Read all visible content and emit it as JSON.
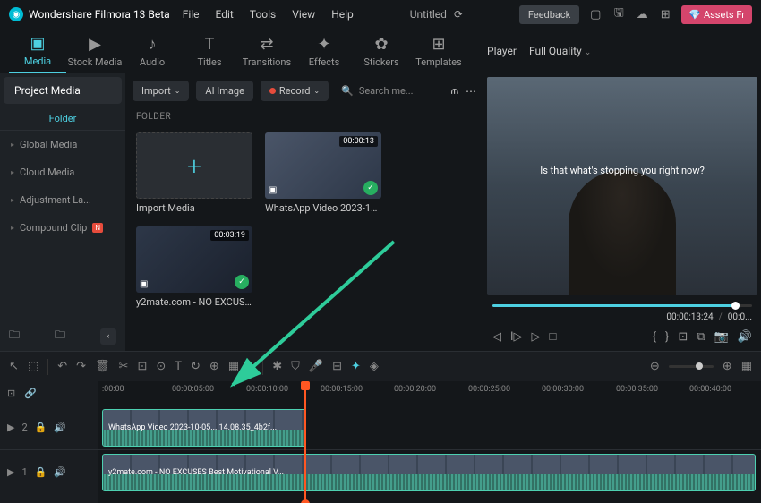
{
  "app": {
    "name": "Wondershare Filmora 13 Beta"
  },
  "menu": [
    "File",
    "Edit",
    "Tools",
    "View",
    "Help"
  ],
  "title": "Untitled",
  "feedback": "Feedback",
  "assets": "Assets Fr",
  "tabs": [
    {
      "label": "Media",
      "icon": "▣"
    },
    {
      "label": "Stock Media",
      "icon": "▶"
    },
    {
      "label": "Audio",
      "icon": "♪"
    },
    {
      "label": "Titles",
      "icon": "T"
    },
    {
      "label": "Transitions",
      "icon": "⇄"
    },
    {
      "label": "Effects",
      "icon": "✦"
    },
    {
      "label": "Stickers",
      "icon": "✿"
    },
    {
      "label": "Templates",
      "icon": "⊞"
    }
  ],
  "player_label": "Player",
  "quality": "Full Quality",
  "sidebar": {
    "header": "Project Media",
    "folder": "Folder",
    "items": [
      "Global Media",
      "Cloud Media",
      "Adjustment La...",
      "Compound Clip"
    ]
  },
  "media_toolbar": {
    "import": "Import",
    "ai_image": "AI Image",
    "record": "Record",
    "search_placeholder": "Search me..."
  },
  "folder_label": "FOLDER",
  "media": [
    {
      "name": "Import Media",
      "type": "import"
    },
    {
      "name": "WhatsApp Video 2023-10-05...",
      "duration": "00:00:13",
      "type": "video"
    },
    {
      "name": "y2mate.com - NO EXCUSES ...",
      "duration": "00:03:19",
      "type": "video"
    }
  ],
  "subtitle": "Is that what's stopping you right now?",
  "timecode": {
    "current": "00:00:13:24",
    "total": "00:0..."
  },
  "ruler": [
    ":00:00",
    "00:00:05:00",
    "00:00:10:00",
    "00:00:15:00",
    "00:00:20:00",
    "00:00:25:00",
    "00:00:30:00",
    "00:00:35:00",
    "00:00:40:00"
  ],
  "tracks": {
    "t2": {
      "num": "2",
      "clip": "WhatsApp Video 2023-10-05... 14.08.35_4b2f..."
    },
    "t1": {
      "num": "1",
      "clip": "y2mate.com - NO EXCUSES  Best Motivational V..."
    }
  }
}
